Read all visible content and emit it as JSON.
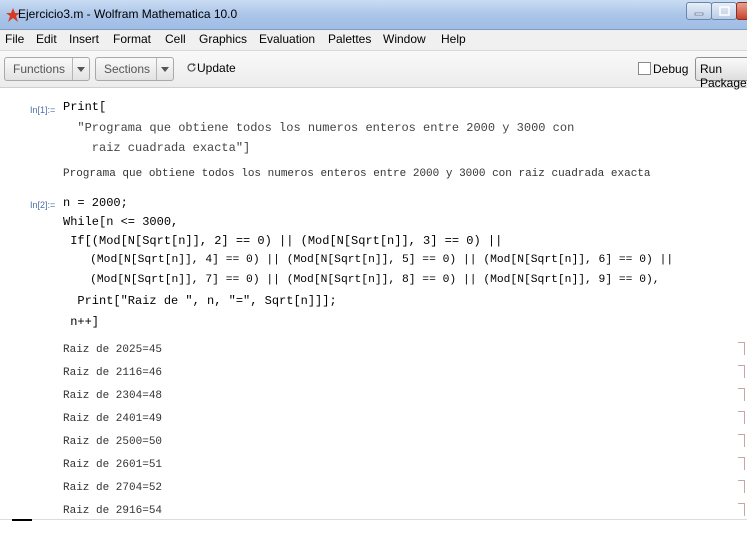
{
  "window": {
    "title": "Ejercicio3.m - Wolfram Mathematica 10.0"
  },
  "menu": [
    "File",
    "Edit",
    "Insert",
    "Format",
    "Cell",
    "Graphics",
    "Evaluation",
    "Palettes",
    "Window",
    "Help"
  ],
  "toolbar": {
    "functions_label": "Functions",
    "sections_label": "Sections",
    "update_label": "Update",
    "debug_label": "Debug",
    "run_label": "Run Package"
  },
  "cells": {
    "in1_label": "In[1]:=",
    "in1_lines": [
      "Print[",
      "  \"Programa que obtiene todos los numeros enteros entre 2000 y 3000 con",
      "    raiz cuadrada exacta\"]"
    ],
    "out1_text": "Programa que obtiene todos los numeros enteros entre 2000 y 3000 con raiz cuadrada exacta",
    "in2_label": "In[2]:=",
    "in2_lines": [
      "n = 2000;",
      "While[n <= 3000,",
      " If[(Mod[N[Sqrt[n]], 2] == 0) || (Mod[N[Sqrt[n]], 3] == 0) ||",
      "    (Mod[N[Sqrt[n]], 4] == 0) || (Mod[N[Sqrt[n]], 5] == 0) || (Mod[N[Sqrt[n]], 6] == 0) ||",
      "    (Mod[N[Sqrt[n]], 7] == 0) || (Mod[N[Sqrt[n]], 8] == 0) || (Mod[N[Sqrt[n]], 9] == 0),",
      "  Print[\"Raiz de \", n, \"=\", Sqrt[n]]];",
      " n++]"
    ],
    "outputs": [
      "Raiz de 2025=45",
      "Raiz de 2116=46",
      "Raiz de 2304=48",
      "Raiz de 2401=49",
      "Raiz de 2500=50",
      "Raiz de 2601=51",
      "Raiz de 2704=52",
      "Raiz de 2916=54"
    ]
  }
}
